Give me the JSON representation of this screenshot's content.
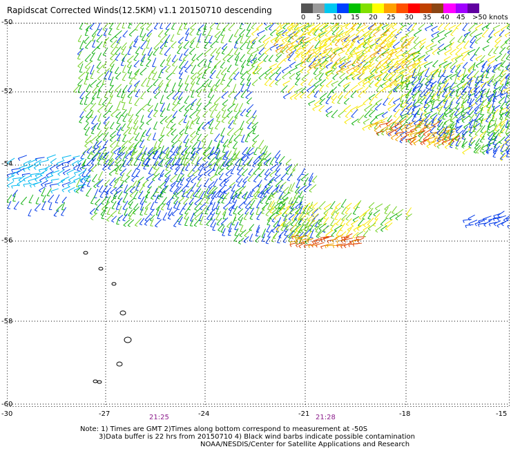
{
  "header": {
    "title": "Rapidscat Corrected Winds(12.5KM) v1.1 20150710 descending"
  },
  "legend": {
    "colors": [
      "#555555",
      "#9a9a9a",
      "#00c8f0",
      "#0040ff",
      "#00c000",
      "#80e000",
      "#ffff00",
      "#ffa000",
      "#ff5000",
      "#ff0000",
      "#c04000",
      "#8b4513",
      "#ff00ff",
      "#a000ff",
      "#6000a0"
    ],
    "labels": [
      "0",
      "5",
      "10",
      "15",
      "20",
      "25",
      "30",
      "35",
      "40",
      "45",
      ">50 knots"
    ]
  },
  "axes": {
    "lat_labels": [
      "-50",
      "-52",
      "-54",
      "-56",
      "-58",
      "-60"
    ],
    "lon_labels": [
      "-30",
      "-27",
      "-24",
      "-21",
      "-18",
      "-15"
    ],
    "time_labels": [
      "21:25",
      "21:28"
    ]
  },
  "notes": {
    "line1": "Note: 1) Times are GMT 2)Times along bottom correspond to measurement at -50S",
    "line2": "3)Data buffer is 22 hrs from 20150710 4) Black wind barbs indicate possible contamination",
    "line3": "NOAA/NESDIS/Center for Satellite Applications and Research"
  }
}
